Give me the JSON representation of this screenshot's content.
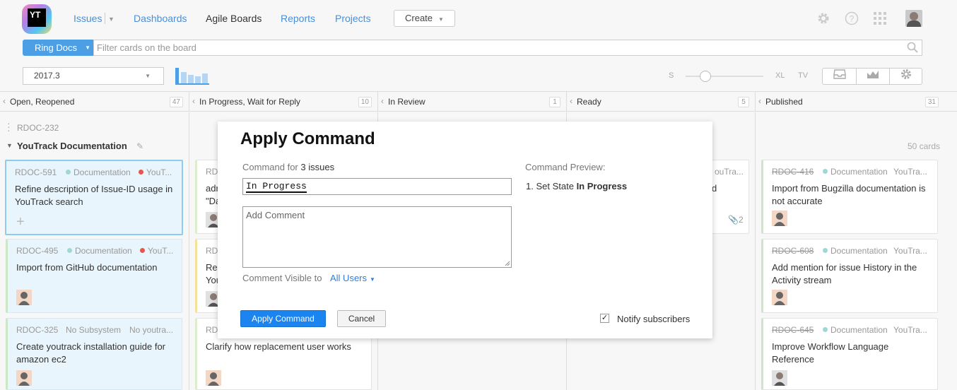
{
  "header": {
    "logo_text": "YT",
    "nav": [
      {
        "label": "Issues",
        "active": false
      },
      {
        "label": "Dashboards",
        "active": false
      },
      {
        "label": "Agile Boards",
        "active": true
      },
      {
        "label": "Reports",
        "active": false
      },
      {
        "label": "Projects",
        "active": false
      }
    ],
    "create_label": "Create",
    "icons": [
      "settings-icon",
      "help-icon",
      "apps-grid-icon"
    ]
  },
  "search": {
    "project_label": "Ring Docs",
    "placeholder": "Filter cards on the board"
  },
  "toolbar": {
    "sprint": "2017.3",
    "size_labels": [
      "S",
      "XL",
      "TV"
    ],
    "card_size_level": 0.25,
    "tool_icons": [
      "inbox-icon",
      "chart-icon",
      "settings-icon"
    ]
  },
  "columns": [
    {
      "name": "Open, Reopened",
      "count": "47"
    },
    {
      "name": "In Progress, Wait for Reply",
      "count": "10"
    },
    {
      "name": "In Review",
      "count": "1"
    },
    {
      "name": "Ready",
      "count": "5"
    },
    {
      "name": "Published",
      "count": "31"
    }
  ],
  "board": {
    "parent_issue": "RDOC-232",
    "swimlane": "YouTrack Documentation",
    "card_count": "50 cards"
  },
  "cards": {
    "c1": {
      "id": "RDOC-591",
      "subsystem": "Documentation",
      "tag": "YouT...",
      "summary": "Refine description of Issue-ID usage in YouTrack search"
    },
    "c2": {
      "id": "RDOC-495",
      "subsystem": "Documentation",
      "tag": "YouT...",
      "summary": "Import from GitHub documentation"
    },
    "c3": {
      "id": "RDOC-325",
      "subsystem": "No Subsystem",
      "tag": "No youtra...",
      "summary": "Create youtrack installation guide for amazon ec2"
    },
    "c4": {
      "id": "RD",
      "summary_l1": "adr",
      "summary_l2": "\"Da"
    },
    "c5": {
      "id": "RD",
      "summary_l1": "Rec",
      "summary_l2": "You"
    },
    "c6": {
      "id": "RD",
      "summary": "Clarify how replacement user works"
    },
    "c7": {
      "tag": "ouTra...",
      "summary_end": "d",
      "attachments": "2"
    },
    "c8": {
      "id": "RDOC-416",
      "subsystem": "Documentation",
      "tag": "YouTra...",
      "summary": "Import from Bugzilla documentation is not accurate"
    },
    "c9": {
      "id": "RDOC-608",
      "subsystem": "Documentation",
      "tag": "YouTra...",
      "summary": "Add mention for issue History in the Activity stream"
    },
    "c10": {
      "id": "RDOC-645",
      "subsystem": "Documentation",
      "tag": "YouTra...",
      "summary": "Improve Workflow Language Reference"
    }
  },
  "dialog": {
    "title": "Apply Command",
    "command_for_prefix": "Command for",
    "command_for_count": "3 issues",
    "command_value": "In Progress",
    "comment_placeholder": "Add Comment",
    "visible_label": "Comment Visible to",
    "visible_value": "All Users",
    "preview_label": "Command Preview:",
    "preview_prefix": "1. Set State",
    "preview_value": "In Progress",
    "apply_label": "Apply Command",
    "cancel_label": "Cancel",
    "notify_label": "Notify subscribers",
    "notify_checked": true
  },
  "colors": {
    "accent": "#1b84ee",
    "link": "#4a8fd8",
    "tag_red": "#e8554e",
    "subsystem_teal": "#9fd8d3"
  }
}
